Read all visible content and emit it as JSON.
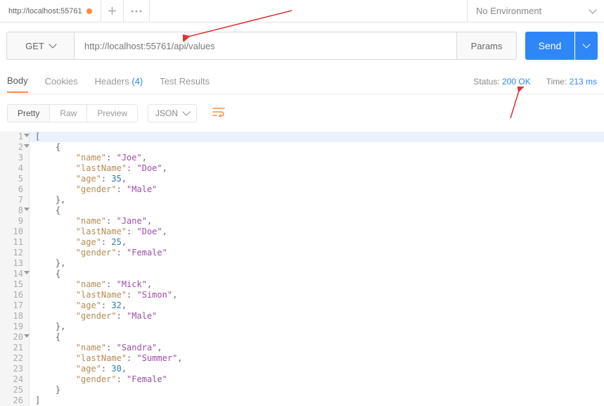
{
  "tab": {
    "title": "http://localhost:55761"
  },
  "env": {
    "selected": "No Environment"
  },
  "request": {
    "method": "GET",
    "url": "http://localhost:55761/api/values",
    "params_label": "Params",
    "send_label": "Send"
  },
  "response_tabs": {
    "body": "Body",
    "cookies": "Cookies",
    "headers": "Headers",
    "headers_count": "(4)",
    "tests": "Test Results"
  },
  "status": {
    "label": "Status:",
    "value": "200 OK"
  },
  "time": {
    "label": "Time:",
    "value": "213 ms"
  },
  "view": {
    "pretty": "Pretty",
    "raw": "Raw",
    "preview": "Preview",
    "format": "JSON"
  },
  "json_data": [
    {
      "name": "Joe",
      "lastName": "Doe",
      "age": 35,
      "gender": "Male"
    },
    {
      "name": "Jane",
      "lastName": "Doe",
      "age": 25,
      "gender": "Female"
    },
    {
      "name": "Mick",
      "lastName": "Simon",
      "age": 32,
      "gender": "Male"
    },
    {
      "name": "Sandra",
      "lastName": "Summer",
      "age": 30,
      "gender": "Female"
    }
  ],
  "code_lines": [
    {
      "n": 1,
      "fold": true,
      "hl": true,
      "t": [
        [
          "p",
          "["
        ]
      ]
    },
    {
      "n": 2,
      "fold": true,
      "t": [
        [
          "p",
          "    {"
        ]
      ]
    },
    {
      "n": 3,
      "t": [
        [
          "p",
          "        "
        ],
        [
          "k",
          "\"name\""
        ],
        [
          "p",
          ": "
        ],
        [
          "s",
          "\"Joe\""
        ],
        [
          "p",
          ","
        ]
      ]
    },
    {
      "n": 4,
      "t": [
        [
          "p",
          "        "
        ],
        [
          "k",
          "\"lastName\""
        ],
        [
          "p",
          ": "
        ],
        [
          "s",
          "\"Doe\""
        ],
        [
          "p",
          ","
        ]
      ]
    },
    {
      "n": 5,
      "t": [
        [
          "p",
          "        "
        ],
        [
          "k",
          "\"age\""
        ],
        [
          "p",
          ": "
        ],
        [
          "n",
          "35"
        ],
        [
          "p",
          ","
        ]
      ]
    },
    {
      "n": 6,
      "t": [
        [
          "p",
          "        "
        ],
        [
          "k",
          "\"gender\""
        ],
        [
          "p",
          ": "
        ],
        [
          "s",
          "\"Male\""
        ]
      ]
    },
    {
      "n": 7,
      "t": [
        [
          "p",
          "    },"
        ]
      ]
    },
    {
      "n": 8,
      "fold": true,
      "t": [
        [
          "p",
          "    {"
        ]
      ]
    },
    {
      "n": 9,
      "t": [
        [
          "p",
          "        "
        ],
        [
          "k",
          "\"name\""
        ],
        [
          "p",
          ": "
        ],
        [
          "s",
          "\"Jane\""
        ],
        [
          "p",
          ","
        ]
      ]
    },
    {
      "n": 10,
      "t": [
        [
          "p",
          "        "
        ],
        [
          "k",
          "\"lastName\""
        ],
        [
          "p",
          ": "
        ],
        [
          "s",
          "\"Doe\""
        ],
        [
          "p",
          ","
        ]
      ]
    },
    {
      "n": 11,
      "t": [
        [
          "p",
          "        "
        ],
        [
          "k",
          "\"age\""
        ],
        [
          "p",
          ": "
        ],
        [
          "n",
          "25"
        ],
        [
          "p",
          ","
        ]
      ]
    },
    {
      "n": 12,
      "t": [
        [
          "p",
          "        "
        ],
        [
          "k",
          "\"gender\""
        ],
        [
          "p",
          ": "
        ],
        [
          "s",
          "\"Female\""
        ]
      ]
    },
    {
      "n": 13,
      "t": [
        [
          "p",
          "    },"
        ]
      ]
    },
    {
      "n": 14,
      "fold": true,
      "t": [
        [
          "p",
          "    {"
        ]
      ]
    },
    {
      "n": 15,
      "t": [
        [
          "p",
          "        "
        ],
        [
          "k",
          "\"name\""
        ],
        [
          "p",
          ": "
        ],
        [
          "s",
          "\"Mick\""
        ],
        [
          "p",
          ","
        ]
      ]
    },
    {
      "n": 16,
      "t": [
        [
          "p",
          "        "
        ],
        [
          "k",
          "\"lastName\""
        ],
        [
          "p",
          ": "
        ],
        [
          "s",
          "\"Simon\""
        ],
        [
          "p",
          ","
        ]
      ]
    },
    {
      "n": 17,
      "t": [
        [
          "p",
          "        "
        ],
        [
          "k",
          "\"age\""
        ],
        [
          "p",
          ": "
        ],
        [
          "n",
          "32"
        ],
        [
          "p",
          ","
        ]
      ]
    },
    {
      "n": 18,
      "t": [
        [
          "p",
          "        "
        ],
        [
          "k",
          "\"gender\""
        ],
        [
          "p",
          ": "
        ],
        [
          "s",
          "\"Male\""
        ]
      ]
    },
    {
      "n": 19,
      "t": [
        [
          "p",
          "    },"
        ]
      ]
    },
    {
      "n": 20,
      "fold": true,
      "t": [
        [
          "p",
          "    {"
        ]
      ]
    },
    {
      "n": 21,
      "t": [
        [
          "p",
          "        "
        ],
        [
          "k",
          "\"name\""
        ],
        [
          "p",
          ": "
        ],
        [
          "s",
          "\"Sandra\""
        ],
        [
          "p",
          ","
        ]
      ]
    },
    {
      "n": 22,
      "t": [
        [
          "p",
          "        "
        ],
        [
          "k",
          "\"lastName\""
        ],
        [
          "p",
          ": "
        ],
        [
          "s",
          "\"Summer\""
        ],
        [
          "p",
          ","
        ]
      ]
    },
    {
      "n": 23,
      "t": [
        [
          "p",
          "        "
        ],
        [
          "k",
          "\"age\""
        ],
        [
          "p",
          ": "
        ],
        [
          "n",
          "30"
        ],
        [
          "p",
          ","
        ]
      ]
    },
    {
      "n": 24,
      "t": [
        [
          "p",
          "        "
        ],
        [
          "k",
          "\"gender\""
        ],
        [
          "p",
          ": "
        ],
        [
          "s",
          "\"Female\""
        ]
      ]
    },
    {
      "n": 25,
      "t": [
        [
          "p",
          "    }"
        ]
      ]
    },
    {
      "n": 26,
      "t": [
        [
          "p",
          "]"
        ]
      ]
    }
  ]
}
